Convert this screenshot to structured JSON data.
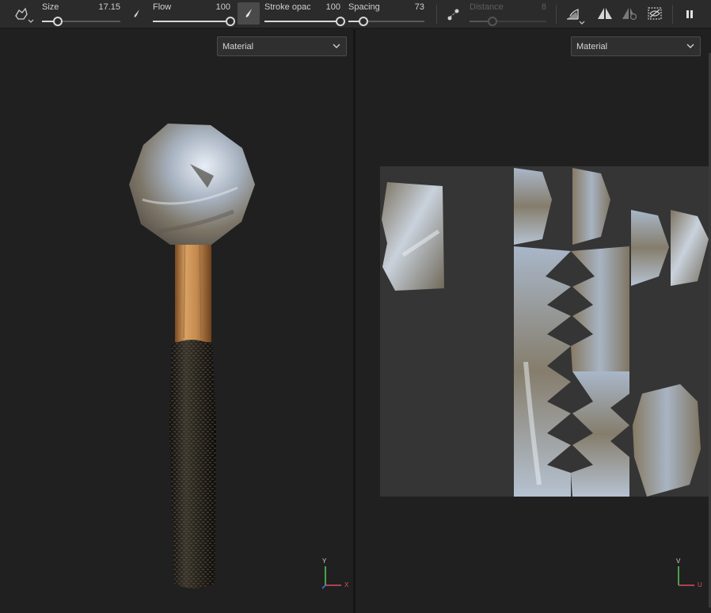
{
  "toolbar": {
    "stroke_tool_icon": "brush-stroke-icon",
    "sliders": {
      "size": {
        "label": "Size",
        "value": "17.15",
        "level": 0.2
      },
      "flow": {
        "label": "Flow",
        "value": "100",
        "level": 1.0
      },
      "stroke_opacity": {
        "label": "Stroke opac",
        "value": "100",
        "level": 1.0
      },
      "spacing": {
        "label": "Spacing",
        "value": "73",
        "level": 0.2
      },
      "distance": {
        "label": "Distance",
        "value": "8",
        "level": 0.3,
        "enabled": false
      }
    },
    "icons": [
      "alpha-stamp-icon",
      "flow-brush-icon",
      "brush-active-icon",
      "lazy-mouse-icon",
      "angle-icon",
      "symmetry-icon",
      "symmetry-settings-icon",
      "mask-icon",
      "pause-icon"
    ]
  },
  "viewport_3d": {
    "channel_dropdown": {
      "value": "Material"
    },
    "axis": {
      "up": "Y",
      "right": "X"
    }
  },
  "viewport_uv": {
    "channel_dropdown": {
      "value": "Material"
    },
    "axis": {
      "up": "V",
      "right": "U"
    }
  },
  "colors": {
    "background": "#202020",
    "toolbar": "#2b2b2b",
    "uv_tile": "#353535",
    "metal": "#9aa6b4",
    "wood": "#c08c52",
    "grip": "#1c1a16",
    "axis_green": "#4fc35a",
    "axis_red": "#d9505a",
    "axis_blue": "#4a6cd8"
  }
}
